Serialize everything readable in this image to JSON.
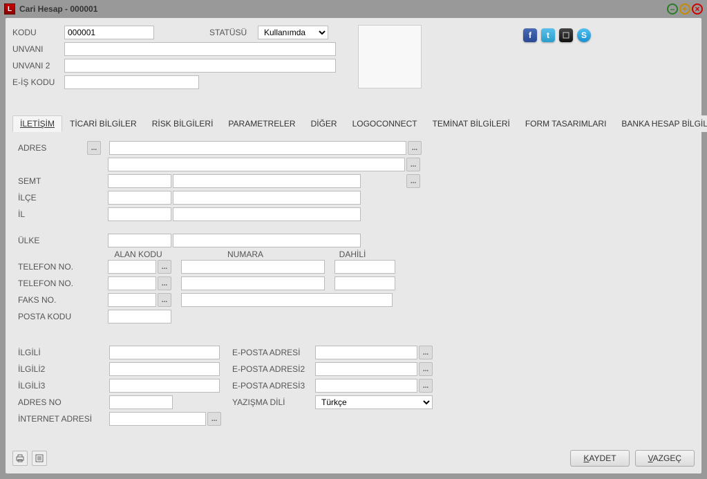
{
  "window": {
    "title": "Cari Hesap - 000001",
    "app_icon_letter": "L"
  },
  "social": {
    "fb": "f",
    "tw": "t",
    "sk": "S"
  },
  "top_form": {
    "kodu_label": "KODU",
    "kodu_value": "000001",
    "statusu_label": "STATÜSÜ",
    "statusu_value": "Kullanımda",
    "unvani_label": "UNVANI",
    "unvani_value": "",
    "unvani2_label": "UNVANI 2",
    "unvani2_value": "",
    "eis_label": "E-İŞ KODU",
    "eis_value": ""
  },
  "tabs": [
    "İLETİŞİM",
    "TİCARİ BİLGİLER",
    "RİSK BİLGİLERİ",
    "PARAMETRELER",
    "DİĞER",
    "LOGOCONNECT",
    "TEMİNAT BİLGİLERİ",
    "FORM TASARIMLARI",
    "BANKA HESAP BİLGİLERİ"
  ],
  "contact": {
    "adres_label": "ADRES",
    "adres_line1": "",
    "adres_line2": "",
    "semt_label": "SEMT",
    "semt_code": "",
    "semt_name": "",
    "ilce_label": "İLÇE",
    "ilce_code": "",
    "ilce_name": "",
    "il_label": "İL",
    "il_code": "",
    "il_name": "",
    "ulke_label": "ÜLKE",
    "ulke_code": "",
    "ulke_name": "",
    "col_alan": "ALAN KODU",
    "col_numara": "NUMARA",
    "col_dahili": "DAHİLİ",
    "tel1_label": "TELEFON NO.",
    "tel1_alan": "",
    "tel1_num": "",
    "tel1_dah": "",
    "tel2_label": "TELEFON NO.",
    "tel2_alan": "",
    "tel2_num": "",
    "tel2_dah": "",
    "faks_label": "FAKS NO.",
    "faks_alan": "",
    "faks_num": "",
    "posta_label": "POSTA KODU",
    "posta_value": "",
    "ilgili_label": "İLGİLİ",
    "ilgili_value": "",
    "ilgili2_label": "İLGİLİ2",
    "ilgili2_value": "",
    "ilgili3_label": "İLGİLİ3",
    "ilgili3_value": "",
    "adresno_label": "ADRES NO",
    "adresno_value": "",
    "internet_label": "İNTERNET ADRESİ",
    "internet_value": "",
    "eposta_label": "E-POSTA ADRESİ",
    "eposta_value": "",
    "eposta2_label": "E-POSTA ADRESİ2",
    "eposta2_value": "",
    "eposta3_label": "E-POSTA ADRESİ3",
    "eposta3_value": "",
    "yazisma_label": "YAZIŞMA DİLİ",
    "yazisma_value": "Türkçe"
  },
  "footer": {
    "save": "KAYDET",
    "save_u": "K",
    "cancel": "VAZGEÇ",
    "cancel_u": "V"
  },
  "ellipsis": "..."
}
